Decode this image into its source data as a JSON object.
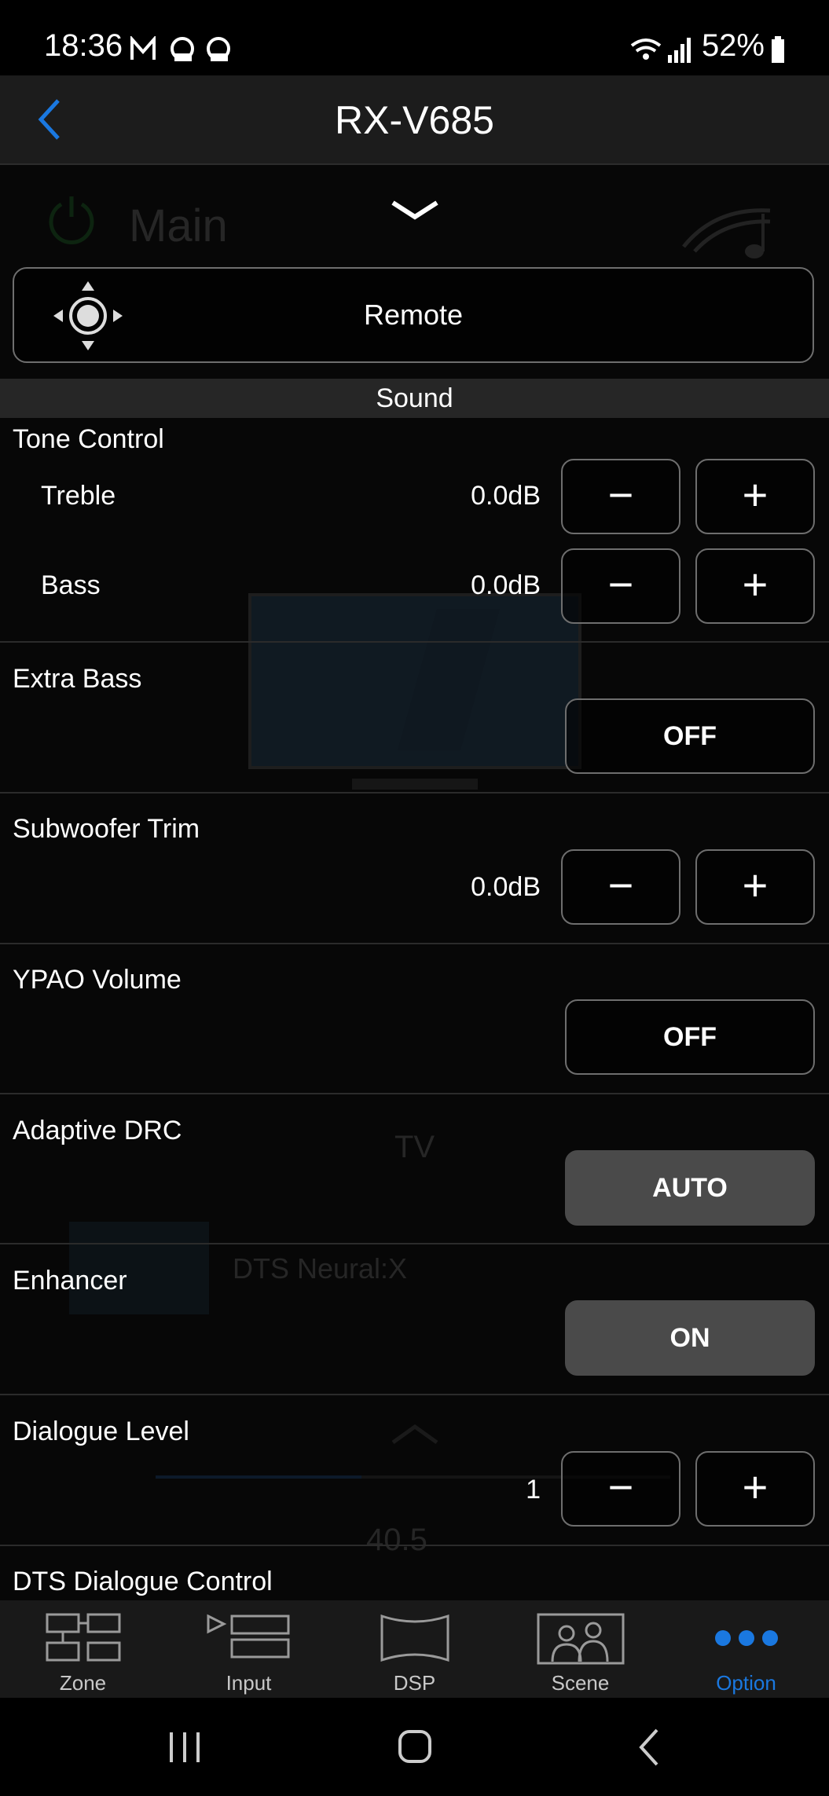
{
  "status_bar": {
    "time": "18:36",
    "battery": "52%"
  },
  "header": {
    "title": "RX-V685"
  },
  "background": {
    "zone_label": "Main",
    "input_name": "TV",
    "sound_program": "DTS Neural:X",
    "volume": "40.5"
  },
  "remote": {
    "label": "Remote"
  },
  "sound": {
    "section_title": "Sound",
    "tone_control": {
      "title": "Tone Control",
      "treble": {
        "label": "Treble",
        "value": "0.0dB"
      },
      "bass": {
        "label": "Bass",
        "value": "0.0dB"
      }
    },
    "extra_bass": {
      "title": "Extra Bass",
      "state": "OFF"
    },
    "subwoofer_trim": {
      "title": "Subwoofer Trim",
      "value": "0.0dB"
    },
    "ypao_volume": {
      "title": "YPAO Volume",
      "state": "OFF"
    },
    "adaptive_drc": {
      "title": "Adaptive DRC",
      "state": "AUTO"
    },
    "enhancer": {
      "title": "Enhancer",
      "state": "ON"
    },
    "dialogue_level": {
      "title": "Dialogue Level",
      "value": "1"
    },
    "dts_dialogue_control": {
      "title": "DTS Dialogue Control"
    }
  },
  "bottom_nav": {
    "items": [
      {
        "label": "Zone"
      },
      {
        "label": "Input"
      },
      {
        "label": "DSP"
      },
      {
        "label": "Scene"
      },
      {
        "label": "Option"
      }
    ],
    "active_index": 4
  },
  "colors": {
    "accent": "#1a78e0",
    "header_bg": "#1c1c1c",
    "section_bg": "#262626"
  }
}
